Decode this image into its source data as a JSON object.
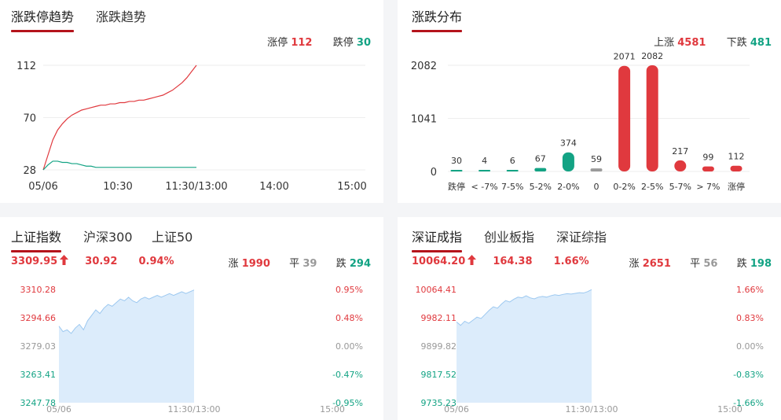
{
  "colors": {
    "up": "#e0393e",
    "down": "#13a384",
    "flat": "#999999",
    "accent": "#b4141c"
  },
  "panel_limit": {
    "tabs": [
      {
        "label": "涨跌停趋势",
        "active": true
      },
      {
        "label": "涨跌趋势",
        "active": false
      }
    ],
    "limit_up_label": "涨停",
    "limit_up_value": "112",
    "limit_down_label": "跌停",
    "limit_down_value": "30"
  },
  "panel_dist": {
    "tabs": [
      {
        "label": "涨跌分布",
        "active": true
      }
    ],
    "up_label": "上涨",
    "up_value": "4581",
    "down_label": "下跌",
    "down_value": "481"
  },
  "panel_sh": {
    "tabs": [
      {
        "label": "上证指数",
        "active": true
      },
      {
        "label": "沪深300",
        "active": false
      },
      {
        "label": "上证50",
        "active": false
      }
    ],
    "price": "3309.95",
    "change": "30.92",
    "pct": "0.94%",
    "rise_label": "涨",
    "rise_value": "1990",
    "flat_label": "平",
    "flat_value": "39",
    "fall_label": "跌",
    "fall_value": "294"
  },
  "panel_sz": {
    "tabs": [
      {
        "label": "深证成指",
        "active": true
      },
      {
        "label": "创业板指",
        "active": false
      },
      {
        "label": "深证综指",
        "active": false
      }
    ],
    "price": "10064.20",
    "change": "164.38",
    "pct": "1.66%",
    "rise_label": "涨",
    "rise_value": "2651",
    "flat_label": "平",
    "flat_value": "56",
    "fall_label": "跌",
    "fall_value": "198"
  },
  "chart_data": [
    {
      "type": "line",
      "x_ticks": [
        "05/06",
        "10:30",
        "11:30/13:00",
        "14:00",
        "15:00"
      ],
      "y_ticks": [
        "112",
        "70",
        "28"
      ],
      "ylim": [
        28,
        112
      ],
      "series": [
        {
          "name": "涨停",
          "color": "#e0393e",
          "values": [
            28,
            40,
            52,
            60,
            65,
            69,
            72,
            74,
            76,
            77,
            78,
            79,
            80,
            80,
            81,
            81,
            82,
            82,
            83,
            83,
            84,
            84,
            85,
            86,
            87,
            88,
            90,
            92,
            95,
            98,
            102,
            107,
            112
          ]
        },
        {
          "name": "跌停",
          "color": "#13a384",
          "values": [
            28,
            32,
            35,
            35,
            34,
            34,
            33,
            33,
            32,
            31,
            31,
            30,
            30,
            30,
            30,
            30,
            30,
            30,
            30,
            30,
            30,
            30,
            30,
            30,
            30,
            30,
            30,
            30,
            30,
            30,
            30,
            30,
            30
          ]
        }
      ],
      "progress": 0.5
    },
    {
      "type": "bar",
      "categories": [
        "跌停",
        "< -7%",
        "7-5%",
        "5-2%",
        "2-0%",
        "0",
        "0-2%",
        "2-5%",
        "5-7%",
        "> 7%",
        "涨停"
      ],
      "values": [
        30,
        4,
        6,
        67,
        374,
        59,
        2071,
        2082,
        217,
        99,
        112
      ],
      "bar_kind": [
        "down",
        "down",
        "down",
        "down",
        "down",
        "flat",
        "up",
        "up",
        "up",
        "up",
        "up"
      ],
      "y_ticks": [
        "2082",
        "1041",
        "0"
      ],
      "ylim": [
        0,
        2082
      ]
    },
    {
      "type": "area",
      "x_ticks": [
        "05/06",
        "11:30/13:00",
        "15:00"
      ],
      "y_left": [
        "3310.28",
        "3294.66",
        "3279.03",
        "3263.41",
        "3247.78"
      ],
      "y_right": [
        "0.95%",
        "0.48%",
        "0.00%",
        "-0.47%",
        "-0.95%"
      ],
      "ylim": [
        3247.78,
        3310.28
      ],
      "values": [
        3290,
        3287,
        3288,
        3286,
        3289,
        3291,
        3288,
        3293,
        3296,
        3299,
        3297,
        3300,
        3302,
        3301,
        3303,
        3305,
        3304,
        3306,
        3304,
        3303,
        3305,
        3306,
        3305,
        3306,
        3307,
        3306,
        3307,
        3308,
        3307,
        3308,
        3309,
        3308,
        3309,
        3310
      ],
      "progress": 0.5
    },
    {
      "type": "area",
      "x_ticks": [
        "05/06",
        "11:30/13:00",
        "15:00"
      ],
      "y_left": [
        "10064.41",
        "9982.11",
        "9899.82",
        "9817.52",
        "9735.23"
      ],
      "y_right": [
        "1.66%",
        "0.83%",
        "0.00%",
        "-0.83%",
        "-1.66%"
      ],
      "ylim": [
        9735.23,
        10064.41
      ],
      "values": [
        9970,
        9960,
        9972,
        9966,
        9975,
        9984,
        9980,
        9992,
        10004,
        10014,
        10010,
        10022,
        10032,
        10028,
        10036,
        10042,
        10040,
        10046,
        10040,
        10037,
        10042,
        10044,
        10042,
        10046,
        10049,
        10047,
        10050,
        10052,
        10051,
        10053,
        10055,
        10054,
        10058,
        10064
      ],
      "progress": 0.5
    }
  ]
}
